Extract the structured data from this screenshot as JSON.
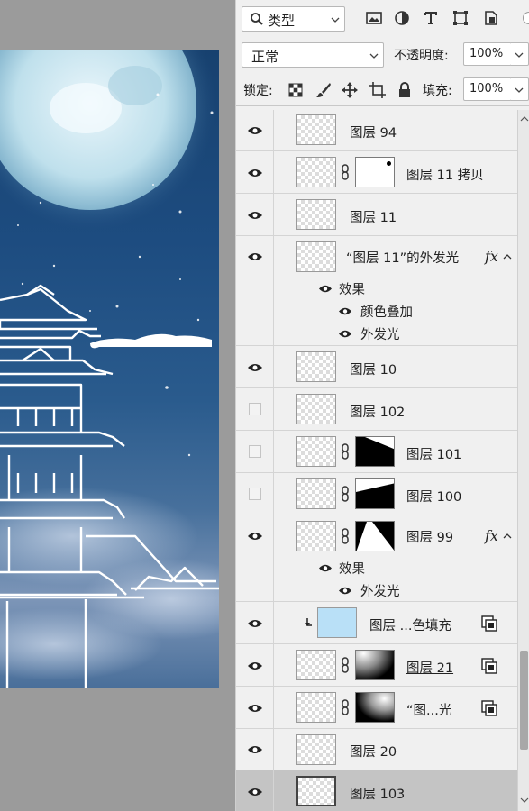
{
  "panel": {
    "filter_kind": "类型",
    "blend_mode": "正常",
    "opacity_label": "不透明度:",
    "opacity_value": "100%",
    "lock_label": "锁定:",
    "fill_label": "填充:",
    "fill_value": "100%"
  },
  "icons": {
    "filter_pixel": "image-icon",
    "filter_adjust": "adjustment-icon",
    "filter_type": "type-icon",
    "filter_shape": "shape-icon",
    "filter_smart": "smart-object-icon"
  },
  "layers": [
    {
      "name": "图层 94",
      "visible": true
    },
    {
      "name": "图层 11 拷贝",
      "visible": true
    },
    {
      "name": "图层 11",
      "visible": true
    },
    {
      "name": "“图层 11”的外发光",
      "visible": true,
      "fx": "fx",
      "effects_title": "效果",
      "effects": [
        "颜色叠加",
        "外发光"
      ]
    },
    {
      "name": "图层 10",
      "visible": true
    },
    {
      "name": "图层 102",
      "visible": false
    },
    {
      "name": "图层 101",
      "visible": false
    },
    {
      "name": "图层 100",
      "visible": false
    },
    {
      "name": "图层 99",
      "visible": true,
      "fx": "fx",
      "effects_title": "效果",
      "effects": [
        "外发光"
      ]
    },
    {
      "name": "图层 ...色填充",
      "visible": true
    },
    {
      "name": "图层 21",
      "visible": true
    },
    {
      "name": "“图...光",
      "visible": true
    },
    {
      "name": "图层 20",
      "visible": true
    },
    {
      "name": "图层 103",
      "visible": true,
      "selected": true
    }
  ],
  "colors": {
    "panel_bg": "#f0f0f0",
    "selected_row": "#c4c4c4",
    "fill_thumb": "#b9e0f7",
    "canvas_sky": "#1d4c80"
  }
}
